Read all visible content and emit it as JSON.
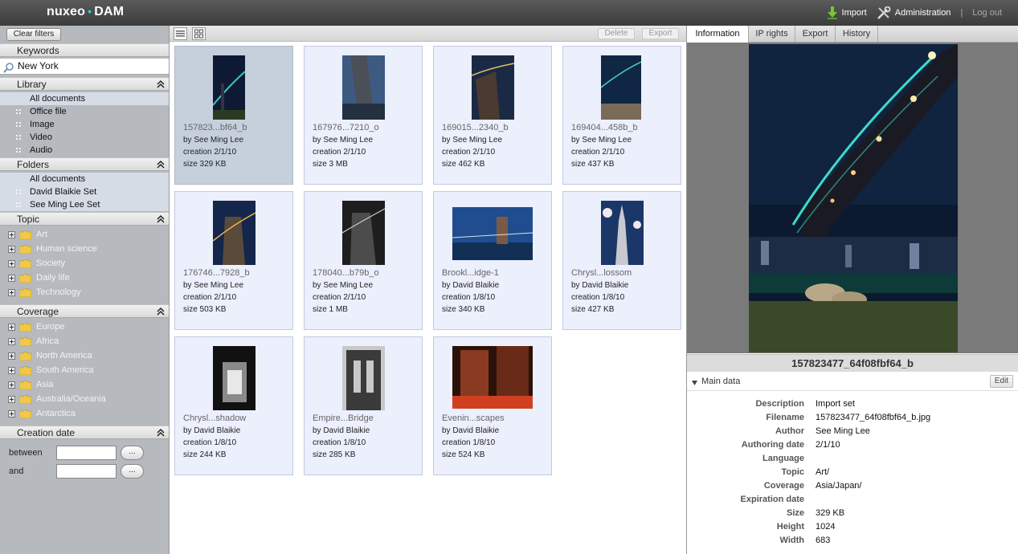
{
  "app": {
    "logo_left": "nuxeo",
    "logo_dot": "•",
    "logo_right": "DAM",
    "nav": {
      "import": "Import",
      "administration": "Administration",
      "separator": "|",
      "logout": "Log out"
    }
  },
  "sidebar": {
    "clear_filters": "Clear filters",
    "keywords": {
      "title": "Keywords",
      "value": "New York"
    },
    "library": {
      "title": "Library",
      "items": [
        "All documents",
        "Office file",
        "Image",
        "Video",
        "Audio"
      ]
    },
    "folders": {
      "title": "Folders",
      "items": [
        "All documents",
        "David Blaikie Set",
        "See Ming Lee Set"
      ]
    },
    "topic": {
      "title": "Topic",
      "items": [
        "Art",
        "Human science",
        "Society",
        "Daily life",
        "Technology"
      ]
    },
    "coverage": {
      "title": "Coverage",
      "items": [
        "Europe",
        "Africa",
        "North America",
        "South America",
        "Asia",
        "Australia/Oceania",
        "Antarctica"
      ]
    },
    "creation_date": {
      "title": "Creation date",
      "between": "between",
      "and": "and",
      "button": "..."
    }
  },
  "toolbar": {
    "delete": "Delete",
    "export": "Export"
  },
  "assets": [
    {
      "title": "157823...bf64_b",
      "author": "by See Ming Lee",
      "creation": "creation 2/1/10",
      "size": "size 329 KB"
    },
    {
      "title": "167976...7210_o",
      "author": "by See Ming Lee",
      "creation": "creation 2/1/10",
      "size": "size 3 MB"
    },
    {
      "title": "169015...2340_b",
      "author": "by See Ming Lee",
      "creation": "creation 2/1/10",
      "size": "size 462 KB"
    },
    {
      "title": "169404...458b_b",
      "author": "by See Ming Lee",
      "creation": "creation 2/1/10",
      "size": "size 437 KB"
    },
    {
      "title": "176746...7928_b",
      "author": "by See Ming Lee",
      "creation": "creation 2/1/10",
      "size": "size 503 KB"
    },
    {
      "title": "178040...b79b_o",
      "author": "by See Ming Lee",
      "creation": "creation 2/1/10",
      "size": "size 1 MB"
    },
    {
      "title": "Brookl...idge-1",
      "author": "by David Blaikie",
      "creation": "creation 1/8/10",
      "size": "size 340 KB"
    },
    {
      "title": "Chrysl...lossom",
      "author": "by David Blaikie",
      "creation": "creation 1/8/10",
      "size": "size 427 KB"
    },
    {
      "title": "Chrysl...shadow",
      "author": "by David Blaikie",
      "creation": "creation 1/8/10",
      "size": "size 244 KB"
    },
    {
      "title": "Empire...Bridge",
      "author": "by David Blaikie",
      "creation": "creation 1/8/10",
      "size": "size 285 KB"
    },
    {
      "title": "Evenin...scapes",
      "author": "by David Blaikie",
      "creation": "creation 1/8/10",
      "size": "size 524 KB"
    }
  ],
  "detail": {
    "tabs": [
      "Information",
      "IP rights",
      "Export",
      "History"
    ],
    "caption": "157823477_64f08fbf64_b",
    "main_data": "Main data",
    "edit": "Edit",
    "fields": [
      {
        "label": "Description",
        "value": "Import set"
      },
      {
        "label": "Filename",
        "value": "157823477_64f08fbf64_b.jpg"
      },
      {
        "label": "Author",
        "value": "See Ming Lee"
      },
      {
        "label": "Authoring date",
        "value": "2/1/10"
      },
      {
        "label": "Language",
        "value": ""
      },
      {
        "label": "Topic",
        "value": "Art/"
      },
      {
        "label": "Coverage",
        "value": "Asia/Japan/"
      },
      {
        "label": "Expiration date",
        "value": ""
      },
      {
        "label": "Size",
        "value": "329 KB"
      },
      {
        "label": "Height",
        "value": "1024"
      },
      {
        "label": "Width",
        "value": "683"
      }
    ]
  }
}
